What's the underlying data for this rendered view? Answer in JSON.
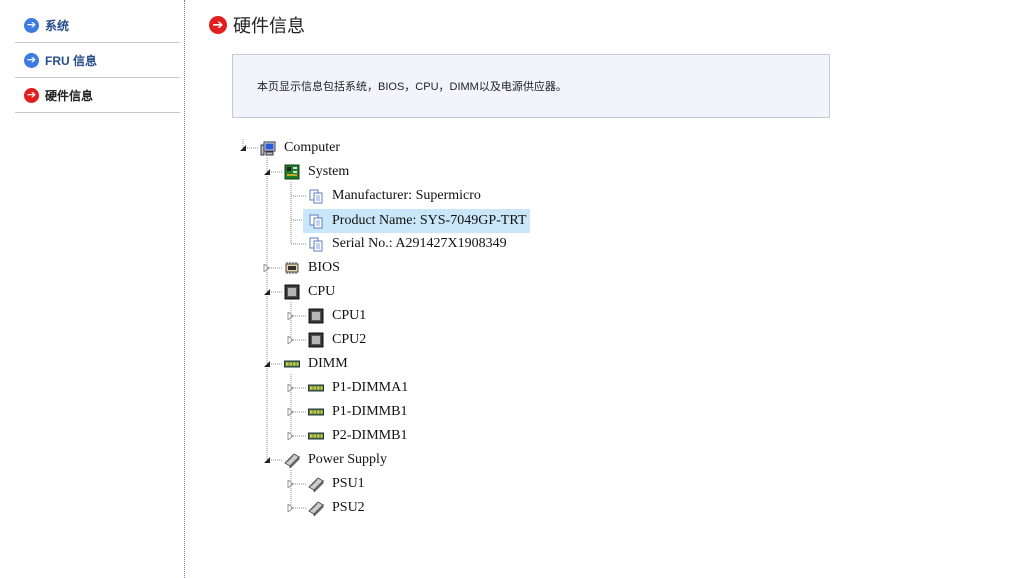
{
  "sidebar": {
    "items": [
      {
        "label": "系统",
        "active": false,
        "icon": "arrow-right-circle-icon"
      },
      {
        "label": "FRU 信息",
        "active": false,
        "icon": "arrow-right-circle-icon"
      },
      {
        "label": "硬件信息",
        "active": true,
        "icon": "arrow-right-circle-icon"
      }
    ]
  },
  "main": {
    "title": "硬件信息",
    "info_text": "本页显示信息包括系统，BIOS，CPU，DIMM以及电源供应器。"
  },
  "tree": {
    "computer": "Computer",
    "system": "System",
    "manufacturer": "Manufacturer: Supermicro",
    "product_name": "Product Name: SYS-7049GP-TRT",
    "serial_no": "Serial No.: A291427X1908349",
    "bios": "BIOS",
    "cpu": "CPU",
    "cpu1": "CPU1",
    "cpu2": "CPU2",
    "dimm": "DIMM",
    "dimm1": "P1-DIMMA1",
    "dimm2": "P1-DIMMB1",
    "dimm3": "P2-DIMMB1",
    "power_supply": "Power Supply",
    "psu1": "PSU1",
    "psu2": "PSU2"
  },
  "colors": {
    "nav_icon": "#3d7be0",
    "active_icon": "#e02020",
    "selection": "#c9e7f8",
    "info_bg": "#f1f4fb"
  }
}
